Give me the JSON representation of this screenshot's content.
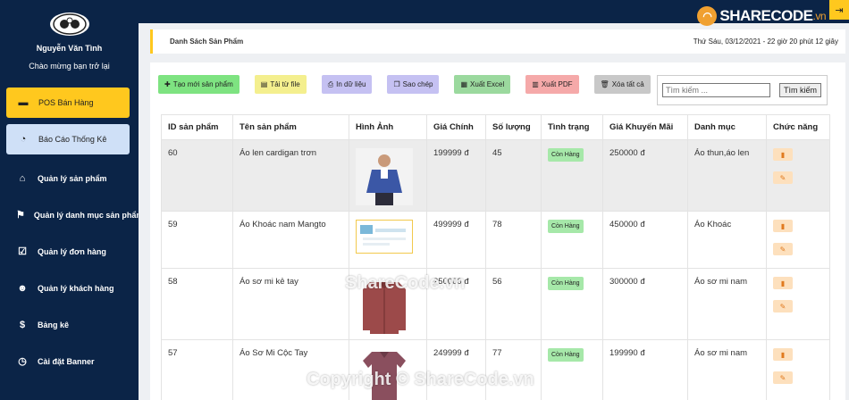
{
  "sidebar": {
    "user_name": "Nguyễn Văn Tình",
    "welcome": "Chào mừng bạn trở lại",
    "items": [
      {
        "label": "POS Bán Hàng",
        "icon": "cart-icon"
      },
      {
        "label": "Báo Cáo Thống Kê",
        "icon": "dashboard-icon"
      },
      {
        "label": "Quản lý sản phẩm",
        "icon": "tag-icon"
      },
      {
        "label": "Quản lý danh mục sản phẩm",
        "icon": "running-icon"
      },
      {
        "label": "Quản lý đơn hàng",
        "icon": "clipboard-check-icon"
      },
      {
        "label": "Quản lý khách hàng",
        "icon": "users-icon"
      },
      {
        "label": "Bảng kê",
        "icon": "dollar-icon"
      },
      {
        "label": "Cài đặt Banner",
        "icon": "clock-icon"
      }
    ]
  },
  "topbar": {
    "logo_main": "SHARECODE",
    "logo_suffix": ".vn"
  },
  "header": {
    "breadcrumb": "Danh Sách Sản Phẩm",
    "datetime": "Thứ Sáu, 03/12/2021 - 22 giờ 20 phút 12 giây"
  },
  "toolbar": {
    "create": "Tạo mới sản phẩm",
    "upload": "Tải từ file",
    "print": "In dữ liệu",
    "copy": "Sao chép",
    "excel": "Xuất Excel",
    "pdf": "Xuất PDF",
    "delete_all": "Xóa tất cả"
  },
  "search": {
    "placeholder": "Tìm kiếm ...",
    "button": "Tìm kiếm"
  },
  "table": {
    "headers": [
      "ID sản phẩm",
      "Tên sản phẩm",
      "Hình Ảnh",
      "Giá Chính",
      "Số lượng",
      "Tình trạng",
      "Giá Khuyến Mãi",
      "Danh mục",
      "Chức năng"
    ],
    "rows": [
      {
        "id": "60",
        "name": "Áo len cardigan trơn",
        "price": "199999 đ",
        "qty": "45",
        "status": "Còn Hàng",
        "promo": "250000 đ",
        "category": "Áo thun,áo len"
      },
      {
        "id": "59",
        "name": "Áo Khoác nam Mangto",
        "price": "499999 đ",
        "qty": "78",
        "status": "Còn Hàng",
        "promo": "450000 đ",
        "category": "Áo Khoác"
      },
      {
        "id": "58",
        "name": "Áo sơ mi kẻ tay",
        "price": "250000 đ",
        "qty": "56",
        "status": "Còn Hàng",
        "promo": "300000 đ",
        "category": "Áo sơ mi nam"
      },
      {
        "id": "57",
        "name": "Áo Sơ Mi Cộc Tay",
        "price": "249999 đ",
        "qty": "77",
        "status": "Còn Hàng",
        "promo": "199990 đ",
        "category": "Áo sơ mi nam"
      }
    ]
  },
  "watermarks": {
    "center": "ShareCode.vn",
    "bottom": "Copyright © ShareCode.vn"
  }
}
